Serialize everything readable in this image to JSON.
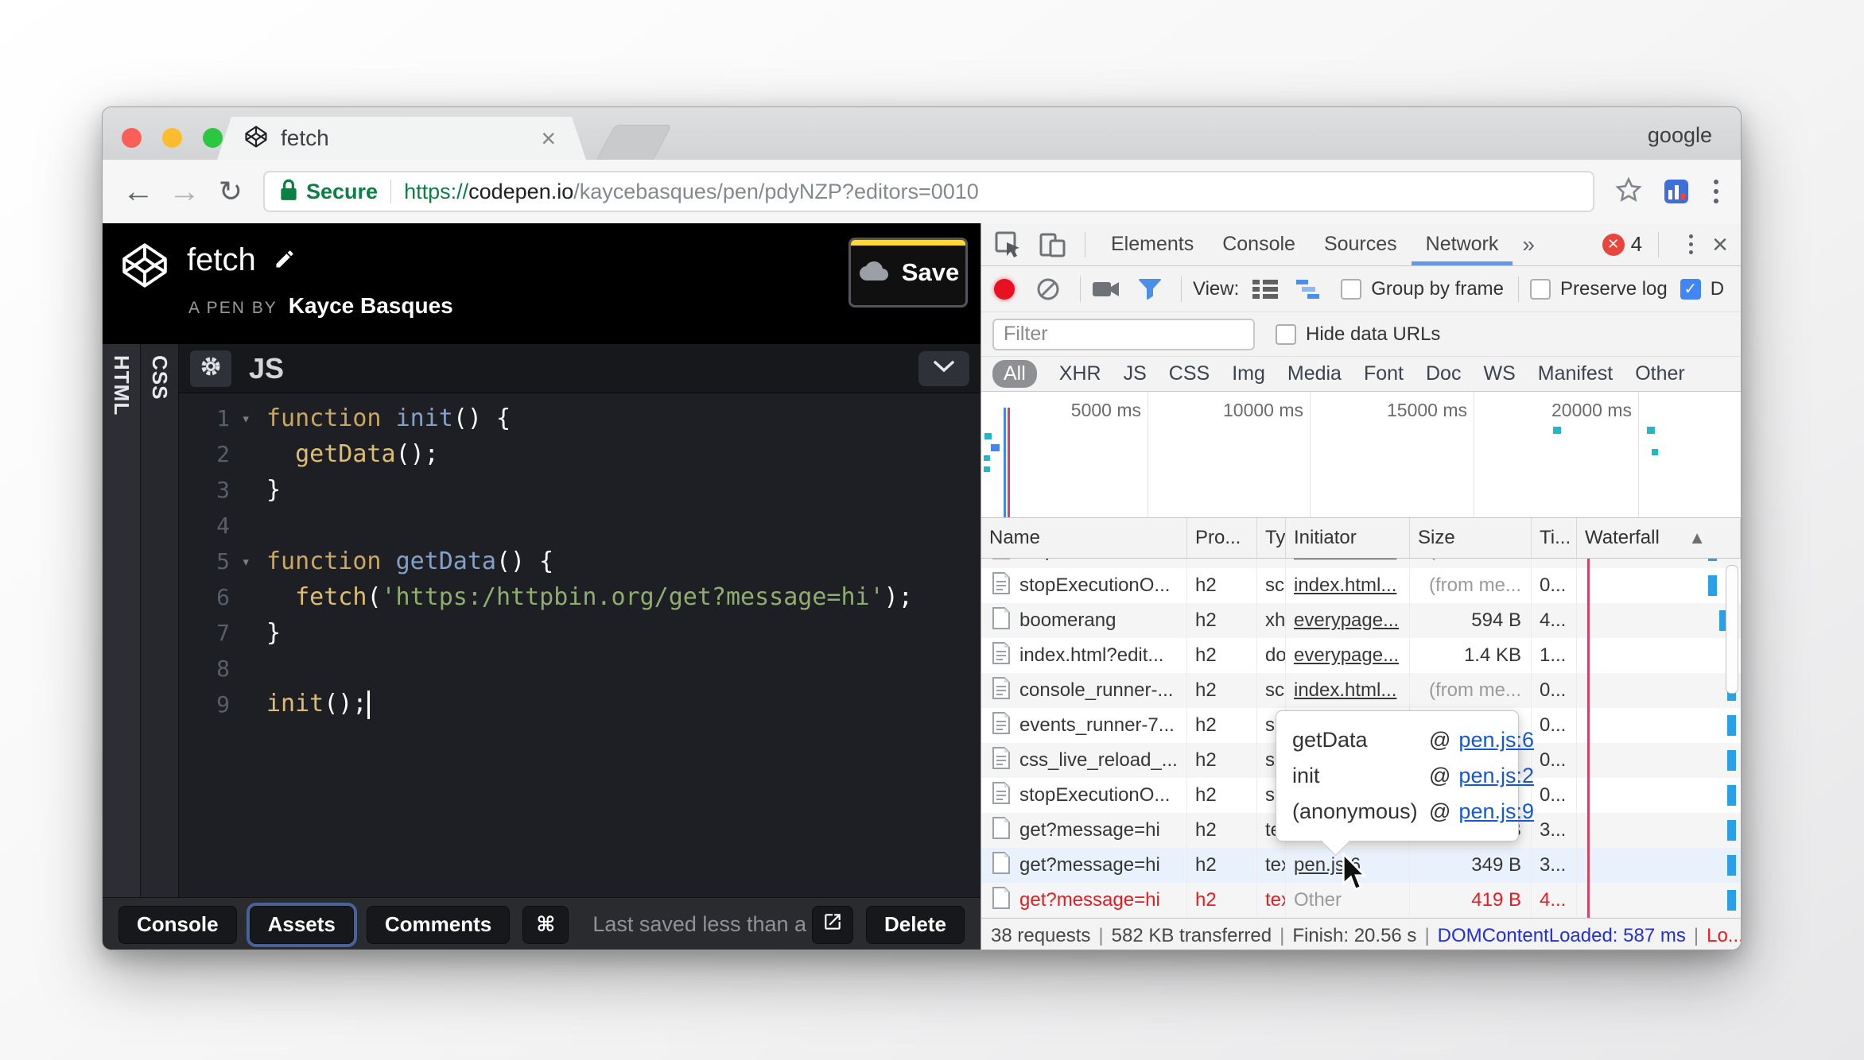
{
  "browser": {
    "profile_label": "google",
    "tab_title": "fetch",
    "tab_close": "×",
    "back": "←",
    "forward": "→",
    "reload": "↻",
    "security_label": "Secure",
    "url": {
      "scheme": "https://",
      "host": "codepen.io",
      "path": "/kaycebasques/pen/pdyNZP?editors=0010"
    }
  },
  "codepen": {
    "header": {
      "title": "fetch",
      "byline_prefix": "A PEN BY",
      "author": "Kayce Basques",
      "save_label": "Save"
    },
    "panel_labels": {
      "html": "HTML",
      "css": "CSS",
      "js": "JS"
    },
    "code_lines": [
      {
        "num": "1",
        "fold": true,
        "segments": [
          {
            "c": "kw",
            "t": "function "
          },
          {
            "c": "fn",
            "t": "init"
          },
          {
            "c": "pl",
            "t": "() {"
          }
        ]
      },
      {
        "num": "2",
        "fold": false,
        "segments": [
          {
            "c": "pl",
            "t": "  "
          },
          {
            "c": "call",
            "t": "getData"
          },
          {
            "c": "pl",
            "t": "();"
          }
        ]
      },
      {
        "num": "3",
        "fold": false,
        "segments": [
          {
            "c": "pl",
            "t": "}"
          }
        ]
      },
      {
        "num": "4",
        "fold": false,
        "segments": []
      },
      {
        "num": "5",
        "fold": true,
        "segments": [
          {
            "c": "kw",
            "t": "function "
          },
          {
            "c": "fn",
            "t": "getData"
          },
          {
            "c": "pl",
            "t": "() {"
          }
        ]
      },
      {
        "num": "6",
        "fold": false,
        "segments": [
          {
            "c": "pl",
            "t": "  "
          },
          {
            "c": "call",
            "t": "fetch"
          },
          {
            "c": "pl",
            "t": "("
          },
          {
            "c": "str",
            "t": "'https:/httpbin.org/get?message=hi'"
          },
          {
            "c": "pl",
            "t": ");"
          }
        ]
      },
      {
        "num": "7",
        "fold": false,
        "segments": [
          {
            "c": "pl",
            "t": "}"
          }
        ]
      },
      {
        "num": "8",
        "fold": false,
        "segments": []
      },
      {
        "num": "9",
        "fold": false,
        "segments": [
          {
            "c": "call",
            "t": "init"
          },
          {
            "c": "pl",
            "t": "();"
          },
          {
            "c": "cursor",
            "t": ""
          }
        ]
      }
    ],
    "footer": {
      "buttons": [
        "Console",
        "Assets",
        "Comments",
        "⌘"
      ],
      "focused_button": "Assets",
      "saved_status": "Last saved less than a minute ago",
      "delete_label": "Delete"
    }
  },
  "devtools": {
    "tabs": [
      "Elements",
      "Console",
      "Sources",
      "Network"
    ],
    "active_tab": "Network",
    "overflow_chevron": "»",
    "error_count": "4",
    "toolbar": {
      "view_label": "View:",
      "group_by_frame_label": "Group by frame",
      "preserve_log_label": "Preserve log",
      "disable_cache_clipped_label": "D",
      "preserve_log_checked": false,
      "group_by_frame_checked": false,
      "disable_cache_checked": true
    },
    "filter_row": {
      "filter_placeholder": "Filter",
      "hide_data_urls_label": "Hide data URLs",
      "hide_data_urls_checked": false
    },
    "type_filters": [
      "All",
      "XHR",
      "JS",
      "CSS",
      "Img",
      "Media",
      "Font",
      "Doc",
      "WS",
      "Manifest",
      "Other"
    ],
    "active_type_filter": "All",
    "timeline_ticks": [
      "5000 ms",
      "10000 ms",
      "15000 ms",
      "20000 ms"
    ],
    "table": {
      "columns": [
        "Name",
        "Pro...",
        "Ty",
        "Initiator",
        "Size",
        "Ti...",
        "Waterfall"
      ],
      "sort_icon": "▲",
      "partial_row": {
        "name": "stopExecutionO...",
        "icon": "doc-text-icon",
        "protocol": "h2",
        "type": "scr",
        "initiator": "index.html...",
        "initiator_link": true,
        "size": "(from me...",
        "size_muted": true,
        "time": "0..."
      },
      "rows": [
        {
          "name": "stopExecutionO...",
          "icon": "doc-text-icon",
          "protocol": "h2",
          "type": "scr",
          "initiator": "index.html...",
          "initiator_link": true,
          "size": "(from me...",
          "size_muted": true,
          "time": "0..."
        },
        {
          "name": "boomerang",
          "icon": "doc-plain-icon",
          "protocol": "h2",
          "type": "xhr",
          "initiator": "everypage...",
          "initiator_link": true,
          "size": "594 B",
          "size_muted": false,
          "time": "4..."
        },
        {
          "name": "index.html?edit...",
          "icon": "doc-text-icon",
          "protocol": "h2",
          "type": "do",
          "initiator": "everypage...",
          "initiator_link": true,
          "size": "1.4 KB",
          "size_muted": false,
          "time": "1..."
        },
        {
          "name": "console_runner-...",
          "icon": "doc-text-icon",
          "protocol": "h2",
          "type": "scr",
          "initiator": "index.html...",
          "initiator_link": true,
          "size": "(from me...",
          "size_muted": true,
          "time": "0..."
        },
        {
          "name": "events_runner-7...",
          "icon": "doc-text-icon",
          "protocol": "h2",
          "type": "s",
          "initiator": "",
          "initiator_link": false,
          "size": "",
          "size_muted": false,
          "time": "0..."
        },
        {
          "name": "css_live_reload_...",
          "icon": "doc-text-icon",
          "protocol": "h2",
          "type": "s",
          "initiator": "",
          "initiator_link": false,
          "size": "",
          "size_muted": false,
          "time": "0..."
        },
        {
          "name": "stopExecutionO...",
          "icon": "doc-text-icon",
          "protocol": "h2",
          "type": "s",
          "initiator": "",
          "initiator_link": false,
          "size": "",
          "size_muted": false,
          "time": "0..."
        },
        {
          "name": "get?message=hi",
          "icon": "doc-plain-icon",
          "protocol": "h2",
          "type": "te",
          "initiator": "get",
          "initiator_link": true,
          "size": "B",
          "size_muted": false,
          "time": "3..."
        },
        {
          "name": "get?message=hi",
          "icon": "doc-plain-icon",
          "protocol": "h2",
          "type": "tex",
          "initiator": "pen.js:6",
          "initiator_link": true,
          "size": "349 B",
          "size_muted": false,
          "time": "3...",
          "highlighted": true
        },
        {
          "name": "get?message=hi",
          "icon": "doc-plain-icon",
          "protocol": "h2",
          "type": "tex",
          "initiator": "Other",
          "initiator_link": false,
          "initiator_muted": true,
          "size": "419 B",
          "size_muted": false,
          "time": "4...",
          "error": true
        }
      ]
    },
    "initiator_tooltip": [
      {
        "fn": "getData",
        "at": "@",
        "loc": "pen.js:6"
      },
      {
        "fn": "init",
        "at": "@",
        "loc": "pen.js:2"
      },
      {
        "fn": "(anonymous)",
        "at": "@",
        "loc": "pen.js:9"
      }
    ],
    "status_bar": {
      "separator": "|",
      "segments": [
        {
          "t": "38 requests",
          "c": "dark"
        },
        {
          "t": "582 KB transferred",
          "c": "dark"
        },
        {
          "t": "Finish: 20.56 s",
          "c": "dark"
        },
        {
          "t": "DOMContentLoaded: 587 ms",
          "c": "blue"
        },
        {
          "t": "Lo...",
          "c": "red"
        }
      ]
    }
  },
  "colors": {
    "traffic_red": "#fb5f57",
    "traffic_yellow": "#fdbc2e",
    "traffic_green": "#2ac840",
    "secure_green": "#0b8043",
    "devtools_accent_blue": "#4285f4",
    "waterfall_bar_blue": "#2aa0e8",
    "error_red": "#e51c23",
    "tooltip_link_blue": "#1558d6",
    "highlight_row": "#e9f1fc",
    "save_bar_yellow": "#ffd73a",
    "load_line_red": "#d64360"
  }
}
